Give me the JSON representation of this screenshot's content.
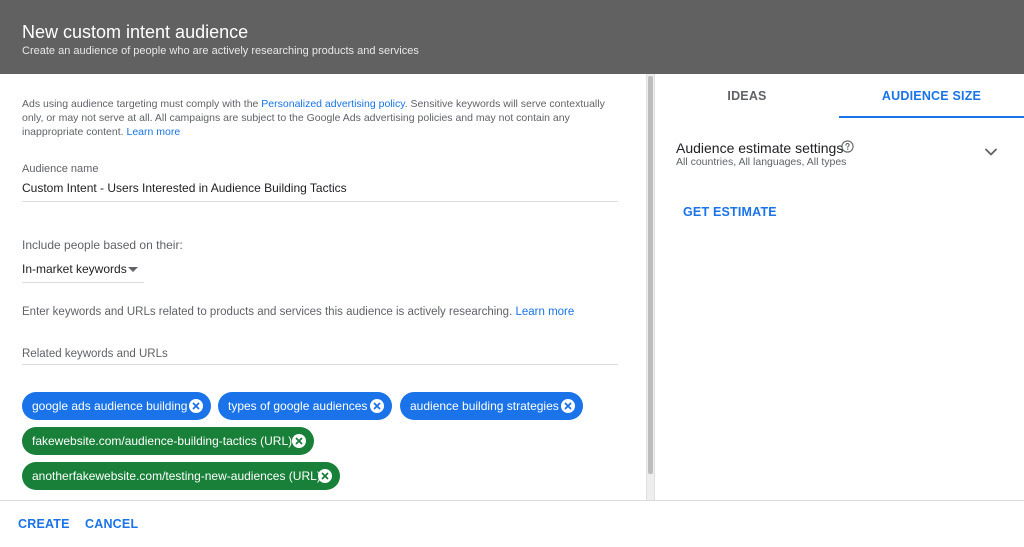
{
  "header": {
    "title": "New custom intent audience",
    "subtitle": "Create an audience of people who are actively researching products and services"
  },
  "policy": {
    "text_before": "Ads using audience targeting must comply with the ",
    "link1": "Personalized advertising policy",
    "text_after": ". Sensitive keywords will serve contextually only, or may not serve at all. All campaigns are subject to the Google Ads advertising policies and may not contain any inappropriate content. ",
    "link2": "Learn more"
  },
  "audience_name": {
    "label": "Audience name",
    "value": "Custom Intent - Users Interested in Audience Building Tactics"
  },
  "include": {
    "label": "Include people based on their:",
    "selected": "In-market keywords"
  },
  "keywords_help": {
    "text": "Enter keywords and URLs related to products and services this audience is actively researching. ",
    "link": "Learn more"
  },
  "related_input": {
    "placeholder": "Related keywords and URLs",
    "value": ""
  },
  "chips": [
    {
      "label": "google ads audience building",
      "kind": "keyword"
    },
    {
      "label": "types of google audiences",
      "kind": "keyword"
    },
    {
      "label": "audience building strategies",
      "kind": "keyword"
    },
    {
      "label": "fakewebsite.com/audience-building-tactics (URL)",
      "kind": "url"
    },
    {
      "label": "anotherfakewebsite.com/testing-new-audiences (URL)",
      "kind": "url"
    }
  ],
  "tabs": [
    {
      "label": "IDEAS",
      "active": false
    },
    {
      "label": "AUDIENCE SIZE",
      "active": true
    }
  ],
  "estimate": {
    "title": "Audience estimate settings",
    "subtitle": "All countries, All languages, All types",
    "help_icon": "help-circle-icon",
    "expand_icon": "chevron-down-icon",
    "button": "GET ESTIMATE"
  },
  "footer": {
    "create": "CREATE",
    "cancel": "CANCEL"
  },
  "colors": {
    "header_bg": "#616161",
    "accent": "#1a73e8",
    "keyword_chip": "#1a73e8",
    "url_chip": "#188038"
  }
}
